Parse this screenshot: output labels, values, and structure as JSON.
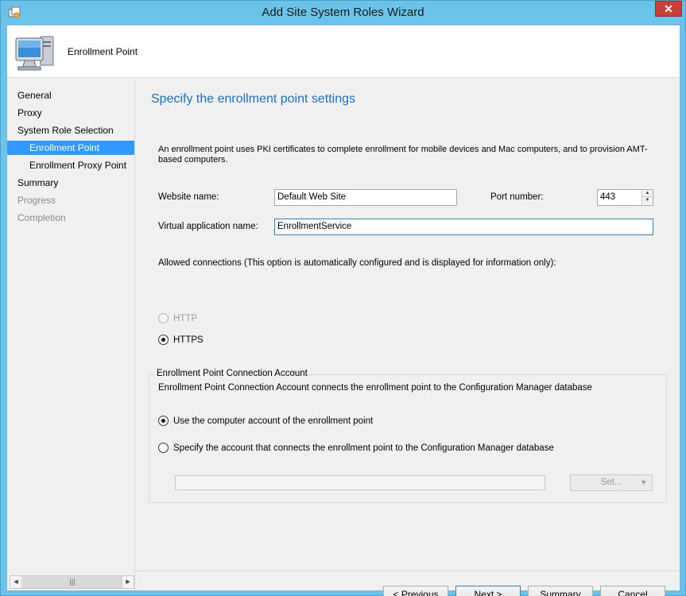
{
  "window": {
    "title": "Add Site System Roles Wizard",
    "close_glyph": "✕"
  },
  "header": {
    "title": "Enrollment Point"
  },
  "nav": {
    "items": [
      {
        "label": "General"
      },
      {
        "label": "Proxy"
      },
      {
        "label": "System Role Selection"
      },
      {
        "label": "Enrollment Point"
      },
      {
        "label": "Enrollment Proxy Point"
      },
      {
        "label": "Summary"
      },
      {
        "label": "Progress"
      },
      {
        "label": "Completion"
      }
    ],
    "selected": "Enrollment Point"
  },
  "main": {
    "title": "Specify the enrollment point settings",
    "description": "An enrollment point uses PKI certificates to complete enrollment for mobile devices and Mac computers, and to provision AMT-based computers.",
    "website_label": "Website name:",
    "website_value": "Default Web Site",
    "port_label": "Port number:",
    "port_value": "443",
    "vapp_label": "Virtual application name:",
    "vapp_value": "EnrollmentService",
    "allowed_label": "Allowed connections (This option is automatically configured and is displayed for information only):",
    "http_label": "HTTP",
    "https_label": "HTTPS",
    "http_checked": false,
    "https_checked": true
  },
  "account": {
    "legend": "Enrollment Point Connection Account",
    "description": "Enrollment Point Connection Account connects the enrollment point to the Configuration Manager database",
    "option_computer": "Use the computer account of the enrollment point",
    "option_specify": "Specify the account that connects the enrollment point to the Configuration Manager database",
    "selected": "computer",
    "account_value": "",
    "set_button": "Set..."
  },
  "footer": {
    "previous": "< Previous",
    "next": "Next >",
    "summary": "Summary",
    "cancel": "Cancel"
  },
  "icons": {
    "app": "wizard-app-icon",
    "header": "computer-monitor-icon",
    "scroll_left": "◂",
    "scroll_right": "▸",
    "scroll_grip": "|||",
    "spin_up": "▲",
    "spin_down": "▼",
    "dropdown": "▼"
  },
  "colors": {
    "titlebar": "#6cc3ea",
    "selection": "#3399ff",
    "title_text": "#1d6fb8",
    "close": "#c7403a"
  }
}
